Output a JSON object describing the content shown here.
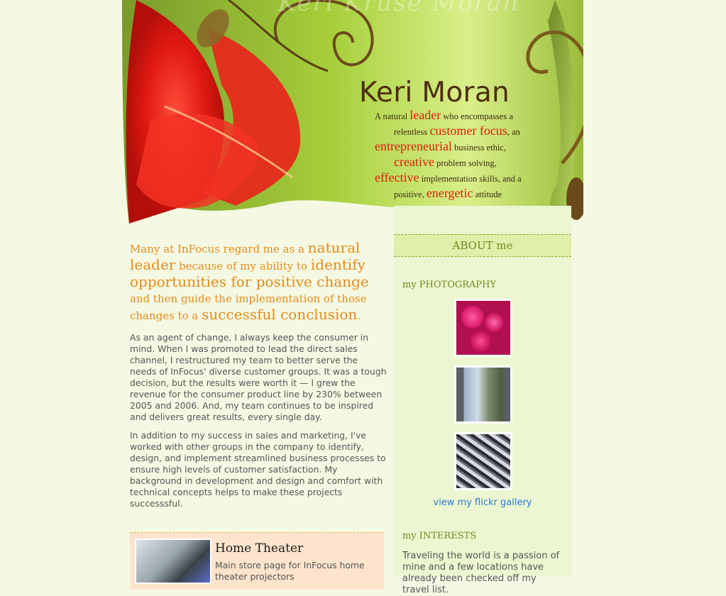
{
  "header": {
    "background_title": "Keri Kruse Moran",
    "name": "Keri Moran",
    "tagline": {
      "t1": "A natural ",
      "h1": "leader",
      "t2": " who encompasses a",
      "t3": "relentless ",
      "h2": "customer focus",
      "t4": ", an",
      "h3": "entrepreneurial",
      "t5": " business ethic,",
      "h4": "creative",
      "t6": " problem solving,",
      "h5": "effective",
      "t7": " implementation skills, and a",
      "t8": "positive, ",
      "h6": "energetic",
      "t9": " attitude"
    }
  },
  "main": {
    "intro": {
      "a": "Many at InFocus regard me as a ",
      "b": "natural leader",
      "c": " because of my ability to ",
      "d": "identify opportunities for positive change",
      "e": " and then guide the implementation of those changes to a ",
      "f": "successful conclusion",
      "g": "."
    },
    "paragraph1": "As an agent of change, I always keep the consumer in mind. When I was promoted to lead the direct sales channel, I restructured my team to better serve the needs of InFocus' diverse customer groups. It was a tough decision, but the results were worth it —  I grew the revenue for the consumer product line by 230% between 2005 and 2006. And, my team continues to be inspired and delivers great results, every single day.",
    "paragraph2": "In addition to my success in sales and marketing, I've worked with other groups in the company to identify, design, and implement streamlined business processes to ensure high levels of customer satisfaction. My background in development and design and comfort with technical concepts helps to make these projects successsful.",
    "product": {
      "title": "Home Theater",
      "description": "Main store page for InFocus home theater projectors"
    }
  },
  "sidebar": {
    "about_label": "ABOUT me",
    "photography_heading": "my PHOTOGRAPHY",
    "flickr_link": "view my flickr gallery",
    "interests_heading": "my INTERESTS",
    "interests_text": "Traveling the world is a passion of mine and a few locations have already been checked off my travel list."
  },
  "colors": {
    "page_bg": "#f5f9e3",
    "intro_orange": "#e58a1a",
    "tagline_red": "#dd1d0c",
    "sidebar_green": "#6e8a1c",
    "link_blue": "#2a7ad0"
  }
}
